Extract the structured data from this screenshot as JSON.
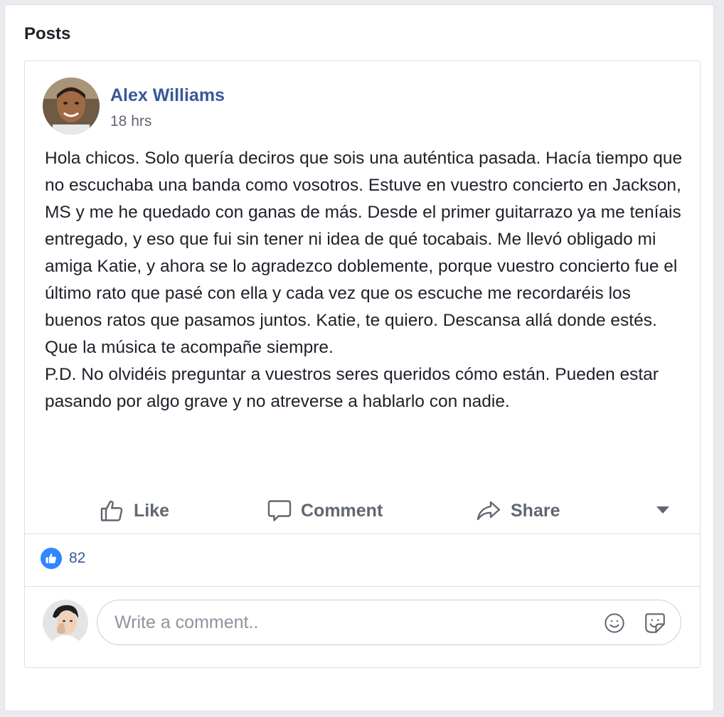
{
  "section": {
    "title": "Posts"
  },
  "post": {
    "author": "Alex Williams",
    "time": "18 hrs",
    "text": "Hola chicos. Solo quería deciros que sois una auténtica pasada. Hacía tiempo que no escuchaba una banda como vosotros. Estuve en vuestro concierto en Jackson, MS y me he quedado con ganas de más. Desde el primer guitarrazo ya me teníais entregado, y eso que fui sin tener ni idea de qué tocabais. Me llevó obligado mi amiga Katie, y ahora se lo agradezco doblemente, porque vuestro concierto fue el último rato que pasé con ella y cada vez que os escuche me recordaréis los buenos ratos que pasamos juntos. Katie, te quiero. Descansa allá donde estés. Que la música te acompañe siempre.",
    "postscript": "P.D. No olvidéis preguntar a vuestros seres queridos cómo están. Pueden estar pasando por algo grave y no atreverse a hablarlo con nadie."
  },
  "actions": {
    "like_label": "Like",
    "comment_label": "Comment",
    "share_label": "Share"
  },
  "reactions": {
    "like_count": "82"
  },
  "comment": {
    "placeholder": "Write a comment.."
  },
  "colors": {
    "accent": "#385898",
    "like_blue": "#2d88ff",
    "secondary_text": "#606770"
  }
}
